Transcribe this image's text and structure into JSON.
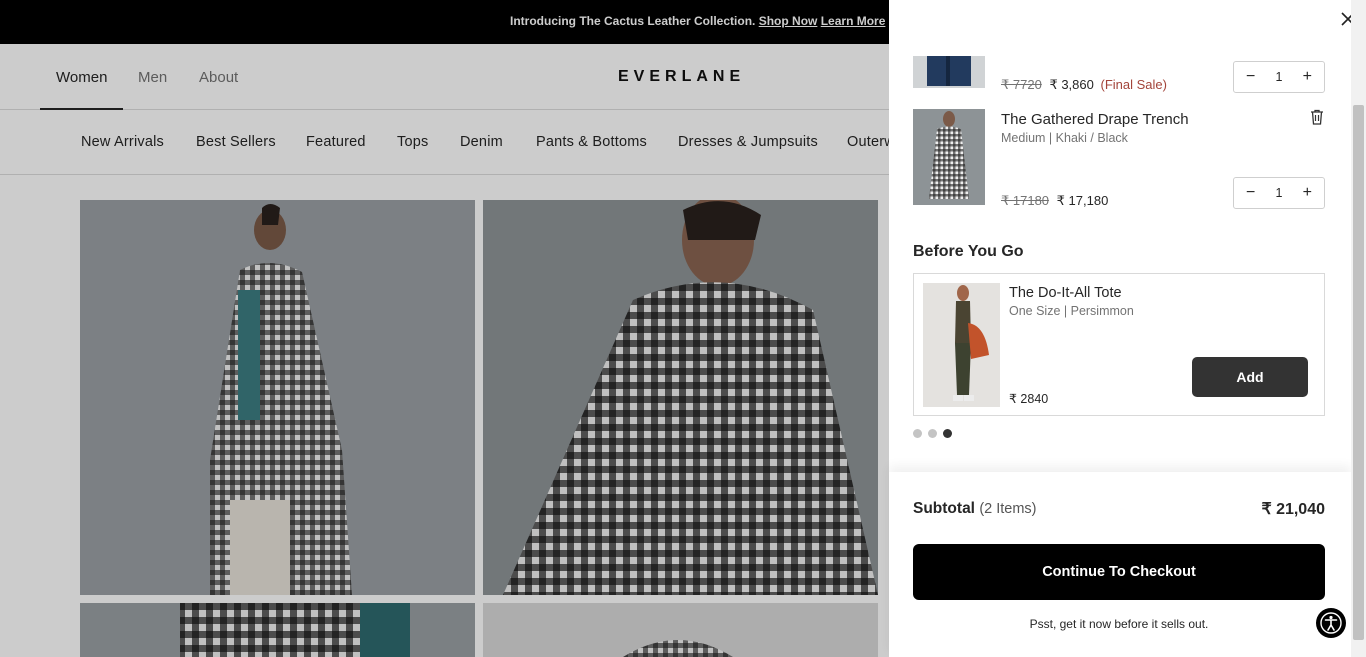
{
  "promo": {
    "text": "Introducing The Cactus Leather Collection.",
    "shop_now": "Shop Now",
    "learn_more": "Learn More"
  },
  "nav": {
    "women": "Women",
    "men": "Men",
    "about": "About",
    "logo": "EVERLANE"
  },
  "categories": [
    "New Arrivals",
    "Best Sellers",
    "Featured",
    "Tops",
    "Denim",
    "Pants & Bottoms",
    "Dresses & Jumpsuits",
    "Outerw"
  ],
  "cart": {
    "items": [
      {
        "title": "",
        "variant": "",
        "price_original": "₹ 7720",
        "price_current": "₹ 3,860",
        "note": "(Final Sale)",
        "qty": "1"
      },
      {
        "title": "The Gathered Drape Trench",
        "variant": "Medium | Khaki / Black",
        "price_original": "₹ 17180",
        "price_current": "₹ 17,180",
        "qty": "1"
      }
    ],
    "qty_minus": "−",
    "qty_plus": "+"
  },
  "recommendations": {
    "title": "Before You Go",
    "product": {
      "title": "The Do-It-All Tote",
      "variant": "One Size | Persimmon",
      "price": "₹ 2840",
      "add_label": "Add"
    },
    "carousel_active_index": 2,
    "carousel_count": 3
  },
  "footer": {
    "subtotal_label": "Subtotal",
    "subtotal_count": "(2 Items)",
    "subtotal_value": "₹ 21,040",
    "checkout_label": "Continue To Checkout",
    "psst": "Psst, get it now before it sells out."
  },
  "colors": {
    "final_sale": "#a3443a",
    "primary_button": "#000000",
    "add_button": "#333333"
  }
}
